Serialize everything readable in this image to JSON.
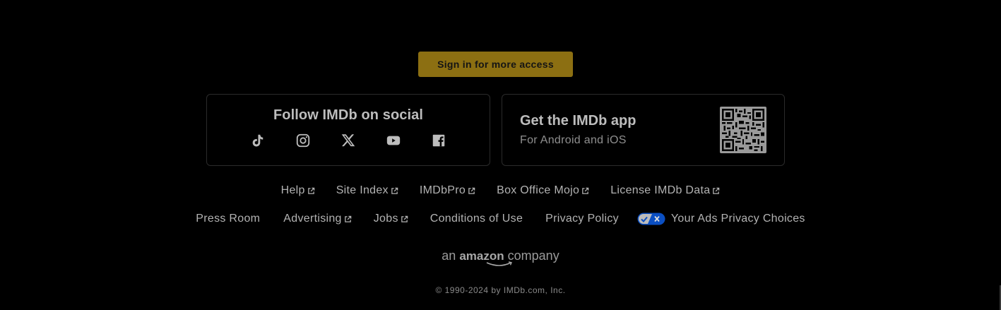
{
  "sign_in": {
    "label": "Sign in for more access"
  },
  "social": {
    "title": "Follow IMDb on social",
    "icons": [
      "tiktok-icon",
      "instagram-icon",
      "x-icon",
      "youtube-icon",
      "facebook-icon"
    ]
  },
  "app": {
    "title": "Get the IMDb app",
    "subtitle": "For Android and iOS"
  },
  "links_row1": [
    "Help",
    "Site Index",
    "IMDbPro",
    "Box Office Mojo",
    "License IMDb Data"
  ],
  "links_row2": [
    "Press Room",
    "Advertising",
    "Jobs",
    "Conditions of Use",
    "Privacy Policy",
    "Your Ads Privacy Choices"
  ],
  "amazon": {
    "prefix": "an",
    "brand": "amazon",
    "suffix": "company"
  },
  "copyright": "© 1990-2024 by IMDb.com, Inc.",
  "colors": {
    "accent": "#8c6f12",
    "background": "#000000",
    "toggle": "#0b4fc2"
  }
}
